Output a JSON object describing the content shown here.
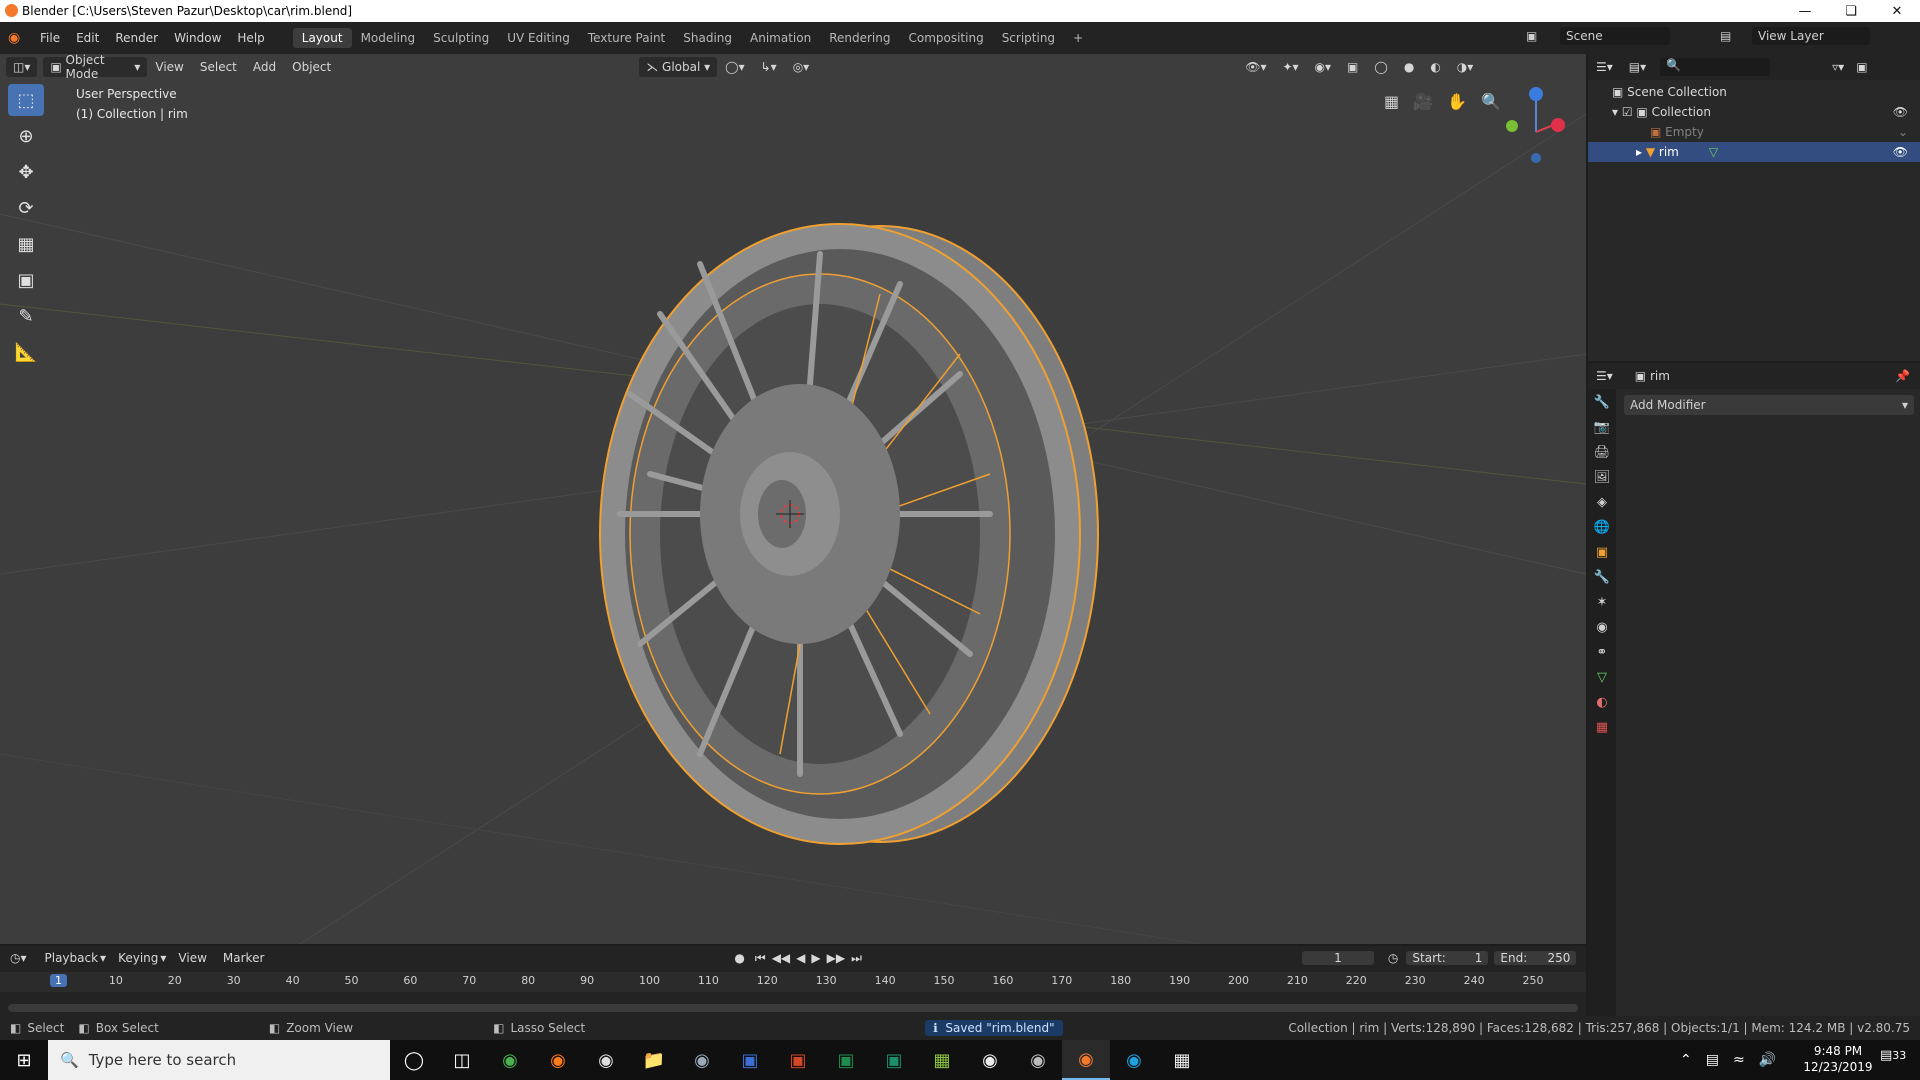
{
  "window": {
    "title": "Blender [C:\\Users\\Steven Pazur\\Desktop\\car\\rim.blend]"
  },
  "topbar": {
    "menus": [
      "File",
      "Edit",
      "Render",
      "Window",
      "Help"
    ],
    "workspaces": [
      "Layout",
      "Modeling",
      "Sculpting",
      "UV Editing",
      "Texture Paint",
      "Shading",
      "Animation",
      "Rendering",
      "Compositing",
      "Scripting"
    ],
    "active_workspace": "Layout",
    "scene": "Scene",
    "view_layer": "View Layer"
  },
  "viewport": {
    "mode": "Object Mode",
    "menus": [
      "View",
      "Select",
      "Add",
      "Object"
    ],
    "orientation": "Global",
    "perspective": "User Perspective",
    "collection_info": "(1) Collection | rim"
  },
  "outliner": {
    "root": "Scene Collection",
    "collection": "Collection",
    "items": [
      "Empty",
      "rim"
    ]
  },
  "properties": {
    "object_name": "rim",
    "add_modifier": "Add Modifier"
  },
  "timeline": {
    "menus": [
      "Playback",
      "Keying",
      "View",
      "Marker"
    ],
    "current_frame": "1",
    "start_label": "Start:",
    "start": "1",
    "end_label": "End:",
    "end": "250",
    "ruler": [
      "1",
      "10",
      "20",
      "30",
      "40",
      "50",
      "60",
      "70",
      "80",
      "90",
      "100",
      "110",
      "120",
      "130",
      "140",
      "150",
      "160",
      "170",
      "180",
      "190",
      "200",
      "210",
      "220",
      "230",
      "240",
      "250"
    ]
  },
  "statusbar": {
    "select": "Select",
    "box_select": "Box Select",
    "zoom_view": "Zoom View",
    "lasso_select": "Lasso Select",
    "saved": "Saved \"rim.blend\"",
    "stats": "Collection | rim | Verts:128,890 | Faces:128,682 | Tris:257,868 | Objects:1/1 | Mem: 124.2 MB | v2.80.75"
  },
  "taskbar": {
    "search_placeholder": "Type here to search",
    "time": "9:48 PM",
    "date": "12/23/2019",
    "notifications": "33"
  },
  "colors": {
    "accent": "#4772b3",
    "selection_outline": "#f0a030",
    "blender_orange": "#f5792a"
  }
}
